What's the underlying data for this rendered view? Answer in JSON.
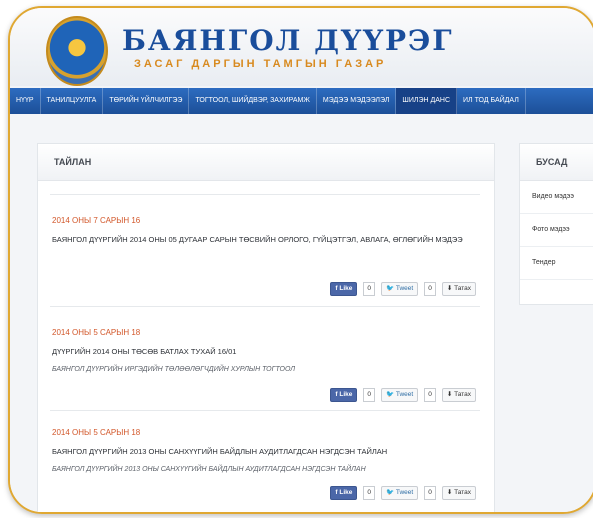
{
  "header": {
    "title": "БАЯНГОЛ ДҮҮРЭГ",
    "subtitle": "ЗАСАГ ДАРГЫН ТАМГЫН ГАЗАР"
  },
  "nav": {
    "items": [
      {
        "label": "НҮҮР"
      },
      {
        "label": "ТАНИЛЦУУЛГА"
      },
      {
        "label": "ТӨРИЙН ҮЙЛЧИЛГЭЭ"
      },
      {
        "label": "ТОГТООЛ, ШИЙДВЭР, ЗАХИРАМЖ"
      },
      {
        "label": "МЭДЭЭ МЭДЭЭЛЭЛ"
      },
      {
        "label": "ШИЛЭН ДАНС"
      },
      {
        "label": "ИЛ ТОД БАЙДАЛ"
      }
    ],
    "active_index": 5
  },
  "main": {
    "section_title": "ТАЙЛАН",
    "posts": [
      {
        "date": "2014 ОНЫ 7 САРЫН 16",
        "title": "БАЯНГОЛ ДҮҮРГИЙН 2014 ОНЫ 05 ДУГААР САРЫН ТӨСВИЙН ОРЛОГО, ГҮЙЦЭТГЭЛ, АВЛАГА, ӨГЛӨГИЙН МЭДЭЭ",
        "subtitle": "",
        "like_label": "Like",
        "like_count": "0",
        "tweet_label": "Tweet",
        "tweet_count": "0",
        "download_label": "Татах"
      },
      {
        "date": "2014 ОНЫ 5 САРЫН 18",
        "title": "ДҮҮРГИЙН 2014 ОНЫ ТӨСӨВ БАТЛАХ ТУХАЙ 16/01",
        "subtitle": "БАЯНГОЛ ДҮҮРГИЙН ИРГЭДИЙН ТӨЛӨӨЛӨГЧДИЙН ХУРЛЫН ТОГТООЛ",
        "like_label": "Like",
        "like_count": "0",
        "tweet_label": "Tweet",
        "tweet_count": "0",
        "download_label": "Татах"
      },
      {
        "date": "2014 ОНЫ 5 САРЫН 18",
        "title": "БАЯНГОЛ ДҮҮРГИЙН 2013 ОНЫ САНХҮҮГИЙН БАЙДЛЫН АУДИТЛАГДСАН НЭГДСЭН ТАЙЛАН",
        "subtitle": "БАЯНГОЛ ДҮҮРГИЙН 2013 ОНЫ САНХҮҮГИЙН БАЙДЛЫН АУДИТЛАГДСАН НЭГДСЭН ТАЙЛАН",
        "like_label": "Like",
        "like_count": "0",
        "tweet_label": "Tweet",
        "tweet_count": "0",
        "download_label": "Татах"
      }
    ]
  },
  "sidebar": {
    "title": "БУСАД",
    "items": [
      {
        "label": "Видео мэдээ"
      },
      {
        "label": "Фото мэдээ"
      },
      {
        "label": "Тендер"
      }
    ]
  },
  "colors": {
    "brand_blue": "#1a4d9b",
    "accent_orange": "#d2572a",
    "frame_gold": "#e0a832"
  },
  "icons": {
    "emblem": "emblem-icon",
    "facebook": "facebook-icon",
    "twitter": "twitter-icon",
    "download": "download-icon"
  }
}
